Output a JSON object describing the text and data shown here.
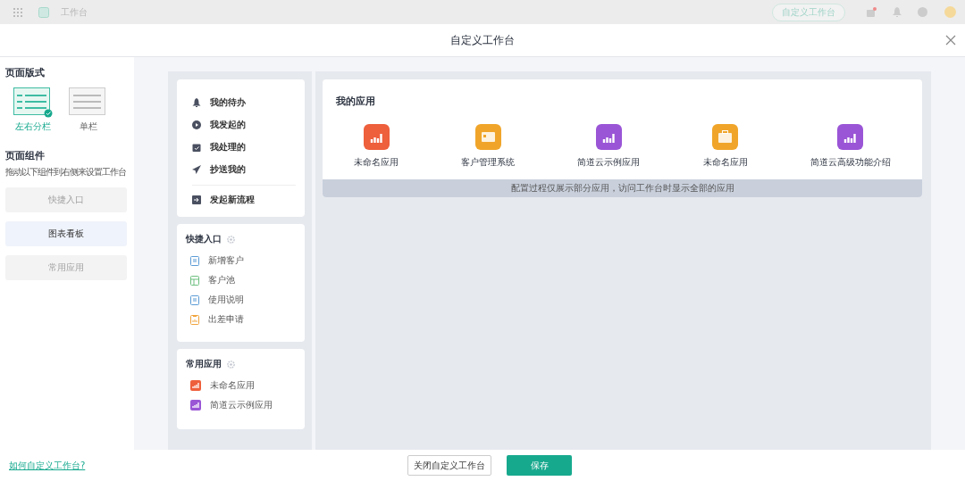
{
  "background_bar": {
    "title": "工作台",
    "customize_button": "自定义工作台",
    "has_notification": true
  },
  "dialog": {
    "title": "自定义工作台"
  },
  "page_layout": {
    "heading": "页面版式",
    "options": [
      {
        "label": "左右分栏",
        "kind": "split",
        "selected": true
      },
      {
        "label": "单栏",
        "kind": "single",
        "selected": false
      }
    ]
  },
  "page_components": {
    "heading": "页面组件",
    "hint": "拖动以下组件到右侧来设置工作台",
    "items": [
      {
        "label": "快捷入口",
        "disabled": true
      },
      {
        "label": "图表看板",
        "disabled": false
      },
      {
        "label": "常用应用",
        "disabled": true
      }
    ]
  },
  "process_card": {
    "items": [
      {
        "label": "我的待办",
        "kind": "bell"
      },
      {
        "label": "我发起的",
        "kind": "play"
      },
      {
        "label": "我处理的",
        "kind": "calendar"
      },
      {
        "label": "抄送我的",
        "kind": "send"
      }
    ],
    "new_flow": "发起新流程"
  },
  "quick_entry_card": {
    "title": "快捷入口",
    "items": [
      {
        "label": "新增客户",
        "kind": "doc",
        "color": "#5b9bd5"
      },
      {
        "label": "客户池",
        "kind": "sheet",
        "color": "#6dbf7f"
      },
      {
        "label": "使用说明",
        "kind": "doc",
        "color": "#5b9bd5"
      },
      {
        "label": "出差申请",
        "kind": "clipboard",
        "color": "#f0a33c"
      }
    ]
  },
  "common_apps_card": {
    "title": "常用应用",
    "items": [
      {
        "label": "未命名应用",
        "color": "#ee5f3c"
      },
      {
        "label": "简道云示例应用",
        "color": "#9a55d6"
      }
    ]
  },
  "my_apps": {
    "title": "我的应用",
    "apps": [
      {
        "label": "未命名应用",
        "kind": "chart",
        "color": "#ee5f3c"
      },
      {
        "label": "客户管理系统",
        "kind": "card",
        "color": "#f0a52a"
      },
      {
        "label": "简道云示例应用",
        "kind": "chart",
        "color": "#9a55d6"
      },
      {
        "label": "未命名应用",
        "kind": "briefcase",
        "color": "#f0a52a"
      },
      {
        "label": "简道云高级功能介绍",
        "kind": "chart",
        "color": "#9a55d6"
      }
    ],
    "notice": "配置过程仅展示部分应用，访问工作台时显示全部的应用"
  },
  "footer": {
    "help_link": "如何自定义工作台?",
    "buttons": [
      {
        "label": "关闭自定义工作台",
        "kind": "secondary"
      },
      {
        "label": "保存",
        "kind": "primary"
      }
    ]
  }
}
